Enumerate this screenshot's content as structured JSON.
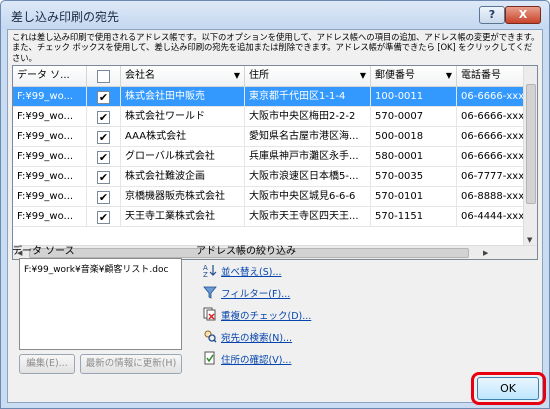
{
  "window": {
    "title": "差し込み印刷の宛先",
    "help_label": "?",
    "close_label": "X"
  },
  "description": "これは差し込み印刷で使用されるアドレス帳です。以下のオプションを使用して、アドレス帳への項目の追加、アドレス帳の変更ができます。また、チェック ボックスを使用して、差し込み印刷の宛先を追加または削除できます。アドレス帳が準備できたら [OK] をクリックしてください。",
  "grid": {
    "columns": [
      "データ ソ...",
      "",
      "会社名",
      "住所",
      "郵便番号",
      "電話番号"
    ],
    "rows": [
      {
        "source": "F:¥99_wo...",
        "checked": "✔",
        "company": "株式会社田中販売",
        "address": "東京都千代田区1-1-4",
        "zip": "100-0011",
        "phone": "06-6666-xxxx",
        "selected": true
      },
      {
        "source": "F:¥99_wo...",
        "checked": "✔",
        "company": "株式会社ワールド",
        "address": "大阪市中央区梅田2-2-2",
        "zip": "570-0007",
        "phone": "06-6666-xxxx",
        "selected": false
      },
      {
        "source": "F:¥99_wo...",
        "checked": "✔",
        "company": "AAA株式会社",
        "address": "愛知県名古屋市港区海...",
        "zip": "500-0018",
        "phone": "06-6666-xxxx",
        "selected": false
      },
      {
        "source": "F:¥99_wo...",
        "checked": "✔",
        "company": "グローバル株式会社",
        "address": "兵庫県神戸市灘区永手...",
        "zip": "580-0001",
        "phone": "06-6666-xxxx",
        "selected": false
      },
      {
        "source": "F:¥99_wo...",
        "checked": "✔",
        "company": "株式会社難波企画",
        "address": "大阪市浪速区日本橋5-...",
        "zip": "570-0035",
        "phone": "06-7777-xxxx",
        "selected": false
      },
      {
        "source": "F:¥99_wo...",
        "checked": "✔",
        "company": "京橋機器販売株式会社",
        "address": "大阪市中央区城見6-6-6",
        "zip": "570-0101",
        "phone": "06-8888-xxxx",
        "selected": false
      },
      {
        "source": "F:¥99_wo...",
        "checked": "✔",
        "company": "天王寺工業株式会社",
        "address": "大阪市天王寺区四天王...",
        "zip": "570-1151",
        "phone": "06-4444-xxxx",
        "selected": false
      }
    ]
  },
  "data_source": {
    "label": "データ ソース",
    "items": [
      "F:¥99_work¥音楽¥顧客リスト.doc"
    ],
    "edit_label": "編集(E)...",
    "refresh_label": "最新の情報に更新(H)"
  },
  "refine": {
    "label": "アドレス帳の絞り込み",
    "items": [
      {
        "icon": "sort-icon",
        "label": "並べ替え(S)..."
      },
      {
        "icon": "filter-icon",
        "label": "フィルター(F)..."
      },
      {
        "icon": "duplicates-icon",
        "label": "重複のチェック(D)..."
      },
      {
        "icon": "find-recipient-icon",
        "label": "宛先の検索(N)..."
      },
      {
        "icon": "validate-address-icon",
        "label": "住所の確認(V)..."
      }
    ]
  },
  "ok_label": "OK",
  "colors": {
    "selection": "#3399ff",
    "link": "#0645ad",
    "highlight": "#e60012"
  }
}
